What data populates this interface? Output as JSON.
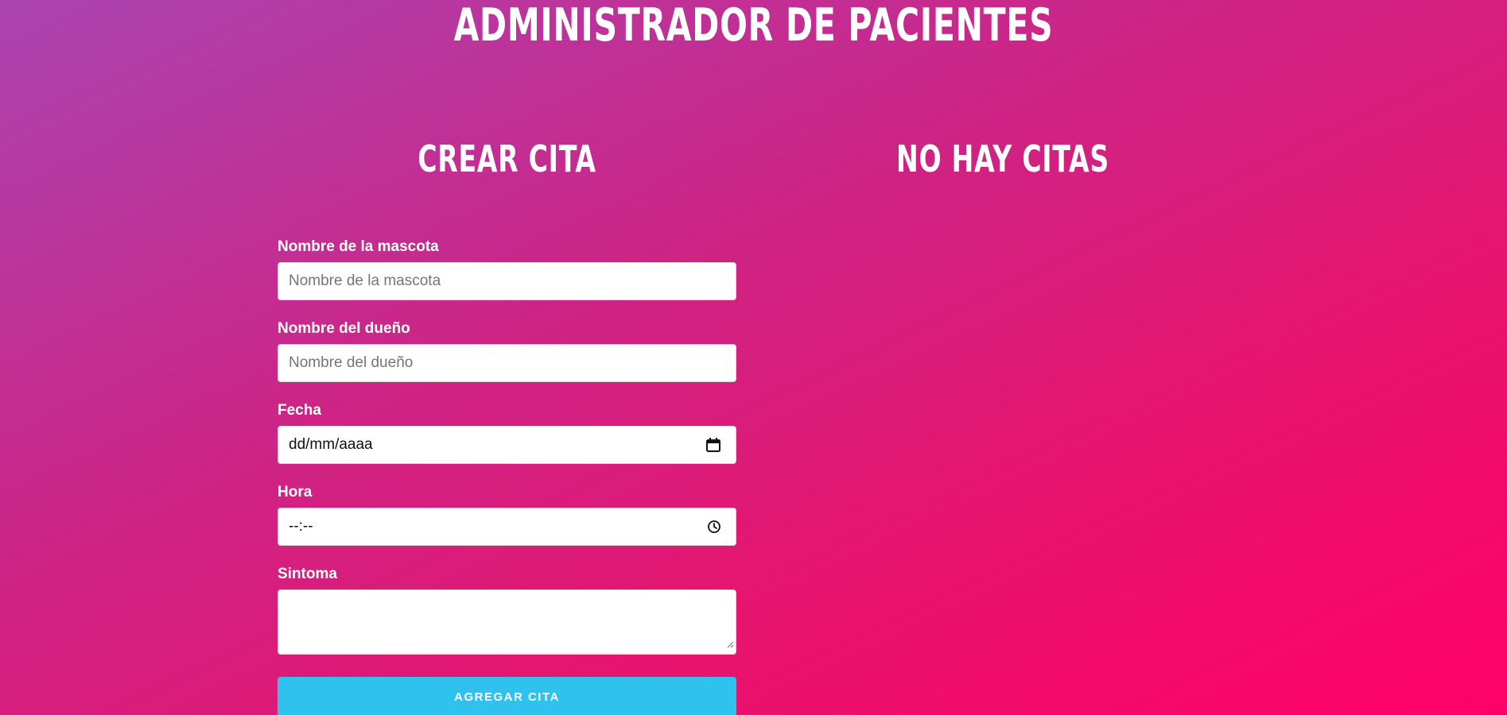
{
  "header": {
    "title": "ADMINISTRADOR DE PACIENTES"
  },
  "form": {
    "title": "CREAR CITA",
    "fields": [
      {
        "label": "Nombre de la mascota",
        "placeholder": "Nombre de la mascota",
        "icon": null
      },
      {
        "label": "Nombre del dueño",
        "placeholder": "Nombre del dueño",
        "icon": null
      },
      {
        "label": "Fecha",
        "placeholder": "dd/mm/aaaa",
        "icon": "calendar-icon"
      },
      {
        "label": "Hora",
        "placeholder": "--:--",
        "icon": "clock-icon"
      }
    ],
    "symptom": {
      "label": "Sintoma",
      "value": ""
    },
    "submit_label": "AGREGAR CITA"
  },
  "appointments": {
    "title": "NO HAY CITAS"
  },
  "colors": {
    "gradient_start": "#aa44b0",
    "gradient_end": "#ff006a",
    "button": "#30c2ef",
    "text": "#ffffff"
  }
}
